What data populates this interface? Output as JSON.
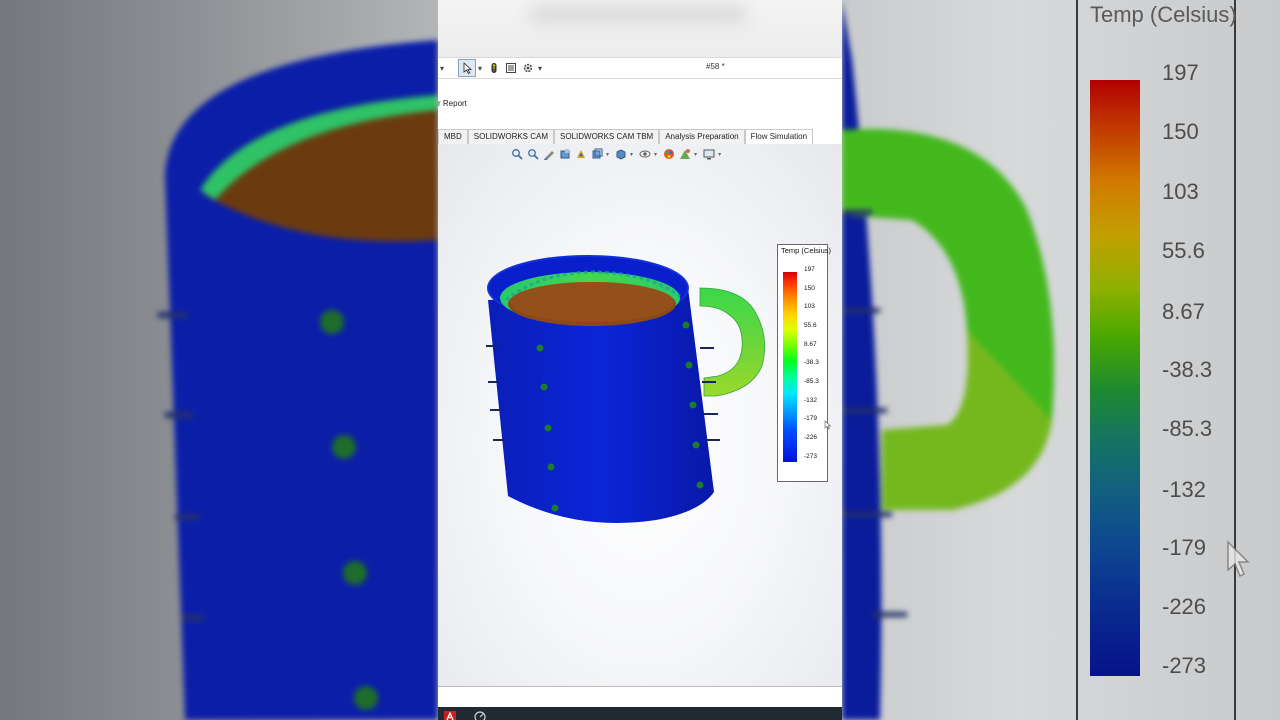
{
  "toolbar": {
    "document_title": "#58 *"
  },
  "ribbon": {
    "report_label": "r Report"
  },
  "command_tabs": [
    {
      "label": "MBD"
    },
    {
      "label": "SOLIDWORKS CAM"
    },
    {
      "label": "SOLIDWORKS CAM TBM"
    },
    {
      "label": "Analysis Preparation"
    },
    {
      "label": "Flow Simulation"
    }
  ],
  "heads_up_icons": [
    "zoom-to-fit-icon",
    "zoom-to-area-icon",
    "previous-view-icon",
    "section-view-icon",
    "dynamic-annotation-icon",
    "view-orientation-icon",
    "display-style-icon",
    "hide-show-icon",
    "edit-appearance-icon",
    "apply-scene-icon",
    "view-settings-icon"
  ],
  "legend": {
    "title": "Temp (Celsius)",
    "ticks": [
      "197",
      "150",
      "103",
      "55.6",
      "8.67",
      "-38.3",
      "-85.3",
      "-132",
      "-179",
      "-226",
      "-273"
    ]
  },
  "colors": {
    "mug_body": "#0a1fcc",
    "liquid": "#8b4a13",
    "handle": "#3fd84a",
    "accent": "#8aa0b8"
  }
}
